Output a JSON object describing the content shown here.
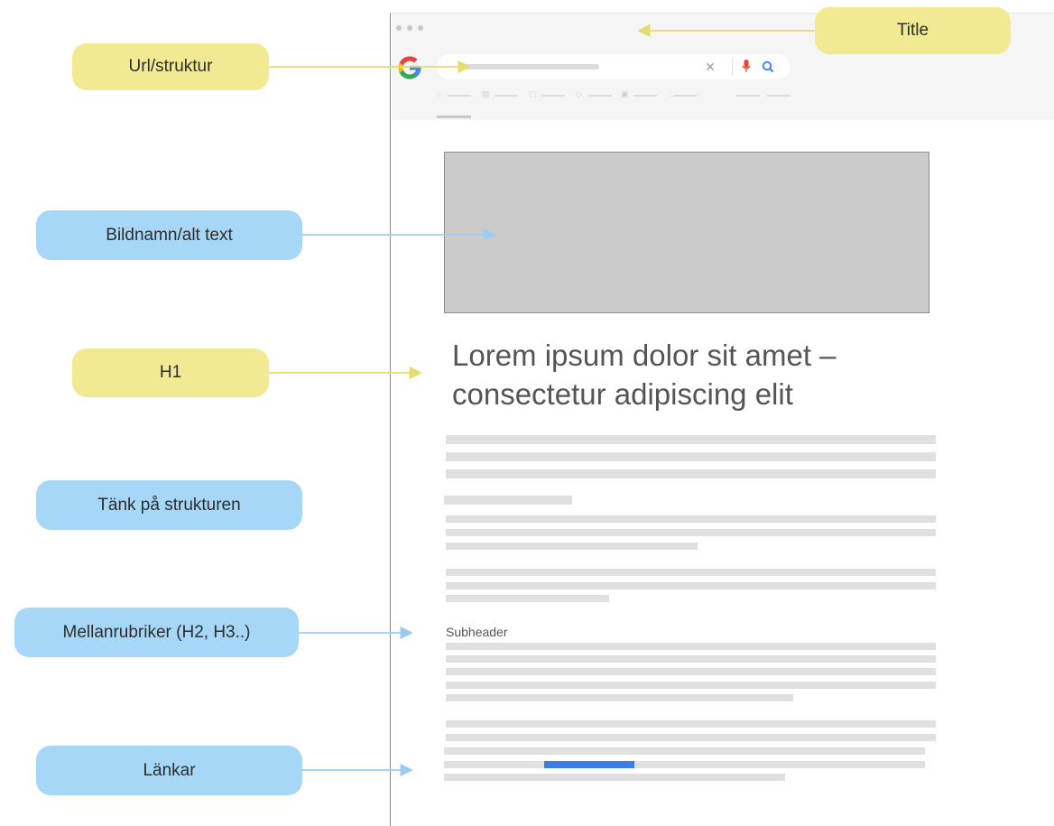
{
  "labels": {
    "title": "Title",
    "url": "Url/struktur",
    "image": "Bildnamn/alt text",
    "h1": "H1",
    "structure": "Tänk på strukturen",
    "subheadings": "Mellanrubriker (H2, H3..)",
    "links": "Länkar"
  },
  "browser": {
    "search_icons": [
      "google-logo",
      "clear-icon",
      "microphone-icon",
      "search-icon"
    ]
  },
  "page": {
    "h1": "Lorem ipsum dolor sit amet – consectetur adipiscing elit",
    "subheader": "Subheader"
  },
  "colors": {
    "yellow_callout": "#f1ea92",
    "blue_callout": "#a7d7f6",
    "link": "#3b7ee8"
  }
}
